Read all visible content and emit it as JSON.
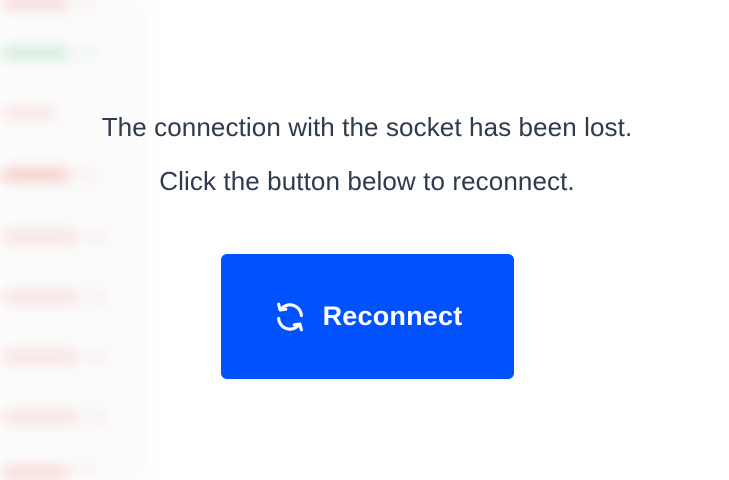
{
  "dialog": {
    "message_line1": "The connection with the socket has been lost.",
    "message_line2": "Click the button below to reconnect.",
    "button_label": "Reconnect",
    "button_icon": "refresh-icon",
    "button_color": "#0052ff",
    "text_color": "#2f3a4d"
  }
}
